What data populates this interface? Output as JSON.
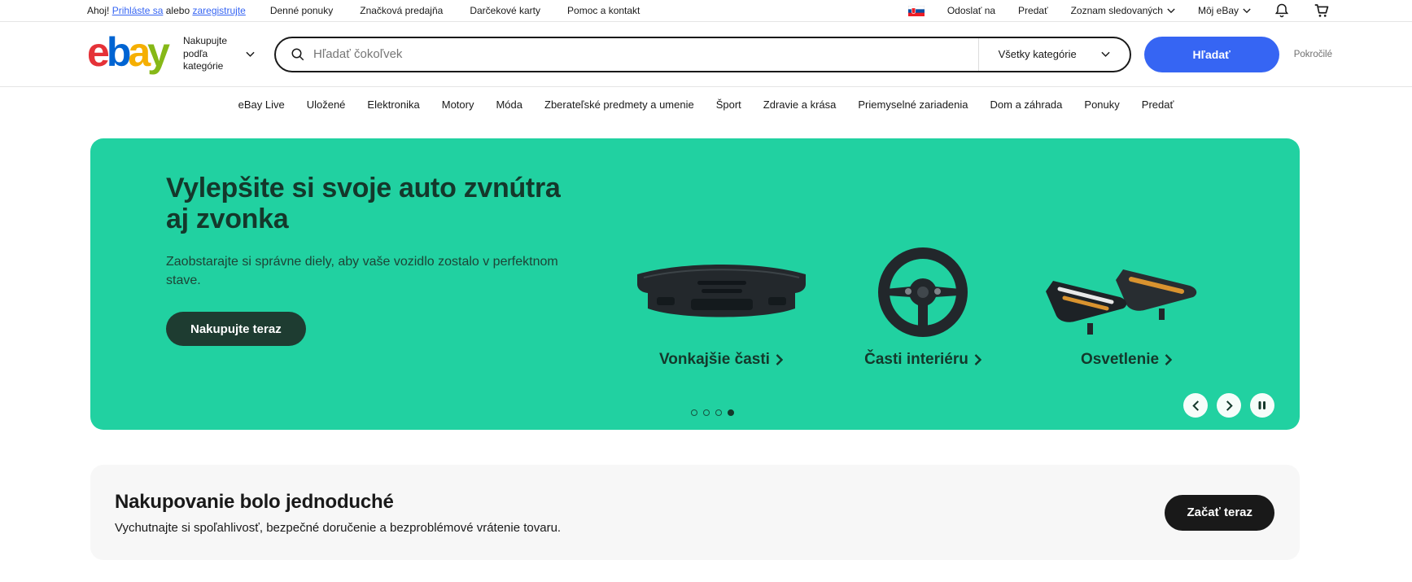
{
  "topbar": {
    "greeting": "Ahoj!",
    "signin": "Prihláste sa",
    "or": "alebo",
    "register": "zaregistrujte",
    "links": [
      "Denné ponuky",
      "Značková predajňa",
      "Darčekové karty",
      "Pomoc a kontakt"
    ],
    "ship_to": "Odoslať na",
    "sell": "Predať",
    "watchlist": "Zoznam sledovaných",
    "my_ebay": "Môj eBay"
  },
  "header": {
    "logo_letters": [
      "e",
      "b",
      "a",
      "y"
    ],
    "shop_by_category": "Nakupujte podľa kategórie",
    "search_placeholder": "Hľadať čokoľvek",
    "search_value": "",
    "all_categories": "Všetky kategórie",
    "search_button": "Hľadať",
    "advanced": "Pokročilé"
  },
  "nav": {
    "items": [
      "eBay Live",
      "Uložené",
      "Elektronika",
      "Motory",
      "Móda",
      "Zberateľské predmety a umenie",
      "Šport",
      "Zdravie a krása",
      "Priemyselné zariadenia",
      "Dom a záhrada",
      "Ponuky",
      "Predať"
    ]
  },
  "hero": {
    "title_line1": "Vylepšite si svoje auto zvnútra",
    "title_line2": "aj zvonka",
    "subtitle": "Zaobstarajte si správne diely, aby vaše vozidlo zostalo v perfektnom stave.",
    "cta": "Nakupujte teraz",
    "categories": [
      {
        "label": "Vonkajšie časti",
        "image": "car-bumper"
      },
      {
        "label": "Časti interiéru",
        "image": "steering-wheel"
      },
      {
        "label": "Osvetlenie",
        "image": "headlights"
      }
    ],
    "dots_total": 4,
    "active_dot": 4,
    "colors": {
      "background": "#21d1a1",
      "text": "#14382b",
      "cta_bg": "#1e3c31"
    }
  },
  "promo": {
    "title": "Nakupovanie bolo jednoduché",
    "subtitle": "Vychutnajte si spoľahlivosť, bezpečné doručenie a bezproblémové vrátenie tovaru.",
    "cta": "Začať teraz"
  },
  "colors": {
    "accent_blue": "#3665f3",
    "ebay_red": "#e53238",
    "ebay_blue": "#0064d2",
    "ebay_yellow": "#f5af02",
    "ebay_green": "#86b817",
    "button_black": "#191919"
  }
}
